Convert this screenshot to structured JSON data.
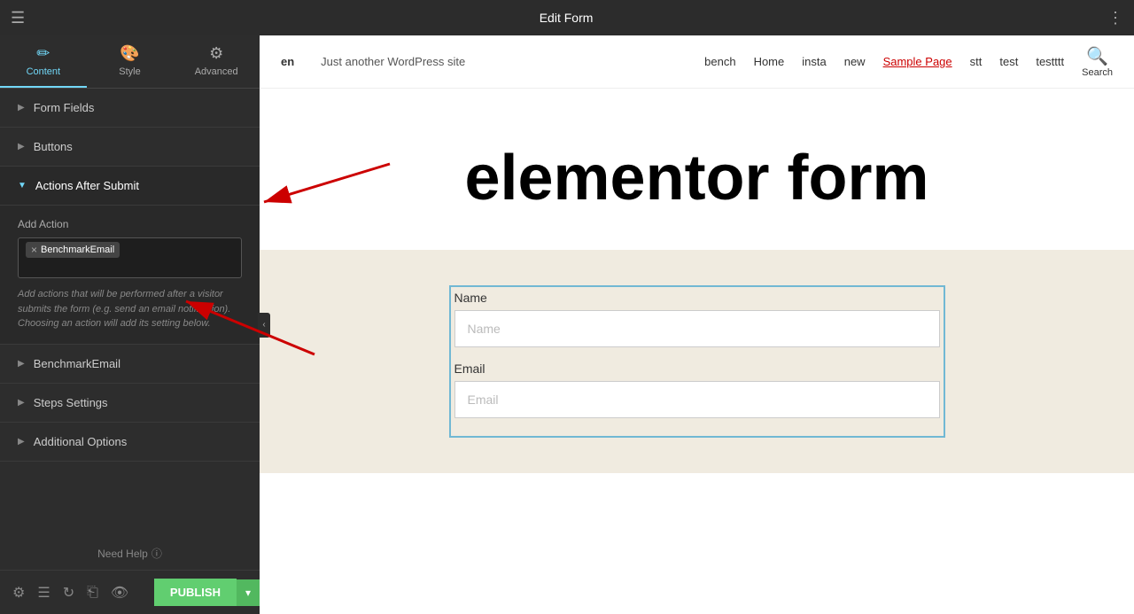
{
  "topbar": {
    "title": "Edit Form",
    "hamburger": "☰",
    "grid": "⋮⋮⋮"
  },
  "sidebar": {
    "tabs": [
      {
        "id": "content",
        "label": "Content",
        "icon": "✏️",
        "active": true
      },
      {
        "id": "style",
        "label": "Style",
        "icon": "🎨",
        "active": false
      },
      {
        "id": "advanced",
        "label": "Advanced",
        "icon": "⚙️",
        "active": false
      }
    ],
    "sections": [
      {
        "id": "form-fields",
        "label": "Form Fields",
        "expanded": false
      },
      {
        "id": "buttons",
        "label": "Buttons",
        "expanded": false
      },
      {
        "id": "actions-after-submit",
        "label": "Actions After Submit",
        "expanded": true
      },
      {
        "id": "benchmark-email",
        "label": "BenchmarkEmail",
        "expanded": false
      },
      {
        "id": "steps-settings",
        "label": "Steps Settings",
        "expanded": false
      },
      {
        "id": "additional-options",
        "label": "Additional Options",
        "expanded": false
      }
    ],
    "actions_section": {
      "add_action_label": "Add Action",
      "tag_value": "BenchmarkEmail",
      "tag_remove": "×",
      "helper_text": "Add actions that will be performed after a visitor submits the form (e.g. send an email notification). Choosing an action will add its setting below."
    },
    "need_help": "Need Help",
    "bottom_buttons": {
      "publish": "PUBLISH",
      "arrow": "▾"
    }
  },
  "wordpress_nav": {
    "lang": "en",
    "site_name": "Just another WordPress site",
    "links": [
      {
        "label": "bench",
        "underlined": false
      },
      {
        "label": "Home",
        "underlined": false
      },
      {
        "label": "insta",
        "underlined": false
      },
      {
        "label": "new",
        "underlined": false
      },
      {
        "label": "Sample Page",
        "underlined": true
      },
      {
        "label": "stt",
        "underlined": false
      },
      {
        "label": "test",
        "underlined": false
      },
      {
        "label": "testttt",
        "underlined": false
      }
    ],
    "search_label": "Search"
  },
  "page": {
    "form_title": "elementor form",
    "form_fields": [
      {
        "label": "Name",
        "placeholder": "Name"
      },
      {
        "label": "Email",
        "placeholder": "Email"
      }
    ]
  }
}
